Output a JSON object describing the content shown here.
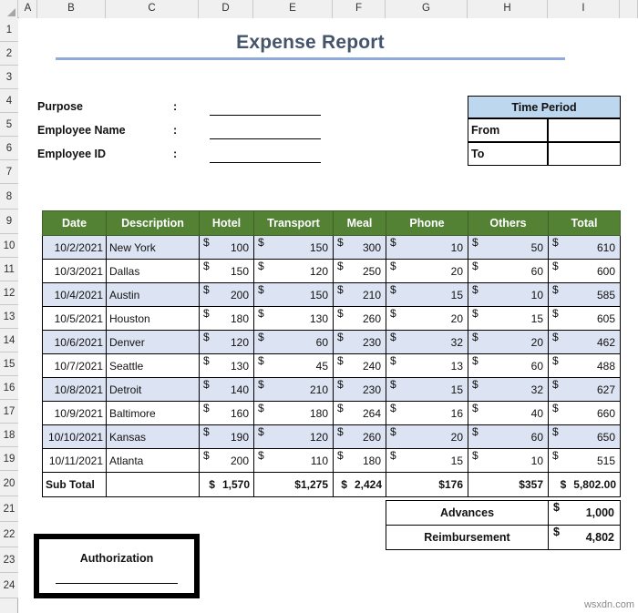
{
  "app": {
    "type": "spreadsheet",
    "watermark": "wsxdn.com"
  },
  "grid": {
    "columns": [
      "A",
      "B",
      "C",
      "D",
      "E",
      "F",
      "G",
      "H",
      "I"
    ],
    "rows": [
      "1",
      "2",
      "3",
      "4",
      "5",
      "6",
      "7",
      "8",
      "9",
      "10",
      "11",
      "12",
      "13",
      "14",
      "15",
      "16",
      "17",
      "18",
      "19",
      "20",
      "21",
      "22",
      "23",
      "24"
    ]
  },
  "report": {
    "title": "Expense Report"
  },
  "form": {
    "separator": ":",
    "fields": [
      {
        "label": "Purpose",
        "value": ""
      },
      {
        "label": "Employee Name",
        "value": ""
      },
      {
        "label": "Employee ID",
        "value": ""
      }
    ]
  },
  "time_period": {
    "header": "Time Period",
    "rows": [
      {
        "label": "From",
        "value": ""
      },
      {
        "label": "To",
        "value": ""
      }
    ]
  },
  "expense_table": {
    "headers": [
      "Date",
      "Description",
      "Hotel",
      "Transport",
      "Meal",
      "Phone",
      "Others",
      "Total"
    ],
    "rows": [
      {
        "date": "10/2/2021",
        "description": "New York",
        "hotel": "100",
        "transport": "150",
        "meal": "300",
        "phone": "10",
        "others": "50",
        "total": "610"
      },
      {
        "date": "10/3/2021",
        "description": "Dallas",
        "hotel": "150",
        "transport": "120",
        "meal": "250",
        "phone": "20",
        "others": "60",
        "total": "600"
      },
      {
        "date": "10/4/2021",
        "description": "Austin",
        "hotel": "200",
        "transport": "150",
        "meal": "210",
        "phone": "15",
        "others": "10",
        "total": "585"
      },
      {
        "date": "10/5/2021",
        "description": "Houston",
        "hotel": "180",
        "transport": "130",
        "meal": "260",
        "phone": "20",
        "others": "15",
        "total": "605"
      },
      {
        "date": "10/6/2021",
        "description": "Denver",
        "hotel": "120",
        "transport": "60",
        "meal": "230",
        "phone": "32",
        "others": "20",
        "total": "462"
      },
      {
        "date": "10/7/2021",
        "description": "Seattle",
        "hotel": "130",
        "transport": "45",
        "meal": "240",
        "phone": "13",
        "others": "60",
        "total": "488"
      },
      {
        "date": "10/8/2021",
        "description": "Detroit",
        "hotel": "140",
        "transport": "210",
        "meal": "230",
        "phone": "15",
        "others": "32",
        "total": "627"
      },
      {
        "date": "10/9/2021",
        "description": "Baltimore",
        "hotel": "160",
        "transport": "180",
        "meal": "264",
        "phone": "16",
        "others": "40",
        "total": "660"
      },
      {
        "date": "10/10/2021",
        "description": "Kansas",
        "hotel": "190",
        "transport": "120",
        "meal": "260",
        "phone": "20",
        "others": "60",
        "total": "650"
      },
      {
        "date": "10/11/2021",
        "description": "Atlanta",
        "hotel": "200",
        "transport": "110",
        "meal": "180",
        "phone": "15",
        "others": "10",
        "total": "515"
      }
    ],
    "currency_symbol": "$",
    "subtotal": {
      "label": "Sub Total",
      "description": "",
      "hotel": "1,570",
      "transport": "1,275",
      "meal": "2,424",
      "phone": "176",
      "others": "357",
      "total": "5,802.00"
    }
  },
  "summary": {
    "rows": [
      {
        "label": "Advances",
        "currency": "$",
        "value": "1,000"
      },
      {
        "label": "Reimbursement",
        "currency": "$",
        "value": "4,802"
      }
    ]
  },
  "authorization": {
    "label": "Authorization"
  },
  "colors": {
    "table_header_green": "#548235",
    "band_blue": "#dce3f2",
    "time_period_blue": "#bdd7ee",
    "title_navy": "#44546a",
    "title_rule_blue": "#8faadc"
  }
}
